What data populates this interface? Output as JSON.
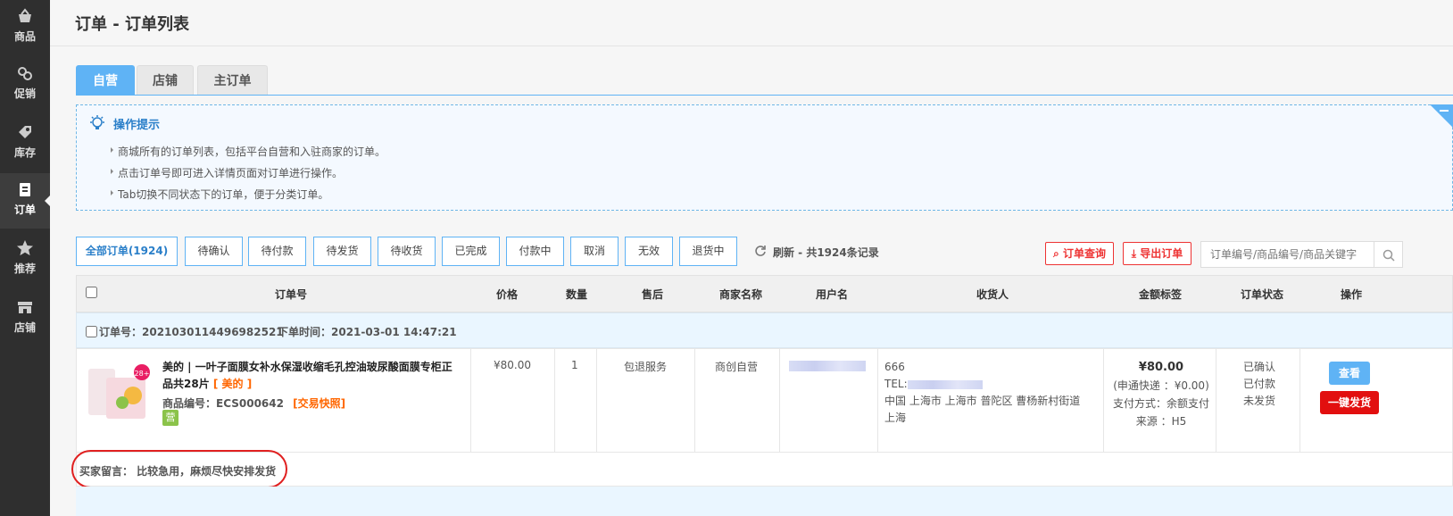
{
  "sidebar": {
    "items": [
      {
        "label": "商品",
        "icon": "basket-icon"
      },
      {
        "label": "促销",
        "icon": "promotion-icon"
      },
      {
        "label": "库存",
        "icon": "tag-icon"
      },
      {
        "label": "订单",
        "icon": "order-icon",
        "active": true
      },
      {
        "label": "推荐",
        "icon": "star-icon"
      },
      {
        "label": "店铺",
        "icon": "store-icon"
      }
    ]
  },
  "header": {
    "title": "订单 - 订单列表"
  },
  "tabs": [
    "自营",
    "店铺",
    "主订单"
  ],
  "tips": {
    "title": "操作提示",
    "items": [
      "商城所有的订单列表，包括平台自营和入驻商家的订单。",
      "点击订单号即可进入详情页面对订单进行操作。",
      "Tab切换不同状态下的订单，便于分类订单。"
    ]
  },
  "filter_tabs": [
    "全部订单(1924)",
    "待确认",
    "待付款",
    "待发货",
    "待收货",
    "已完成",
    "付款中",
    "取消",
    "无效",
    "退货中"
  ],
  "refresh_label": "刷新 - 共1924条记录",
  "actions": {
    "query": "订单查询",
    "export": "导出订单"
  },
  "search": {
    "placeholder": "订单编号/商品编号/商品关键字"
  },
  "table": {
    "headers": [
      "订单号",
      "价格",
      "数量",
      "售后",
      "商家名称",
      "用户名",
      "收货人",
      "金额标签",
      "订单状态",
      "操作"
    ]
  },
  "order": {
    "number_label": "订单号：2021030114496982521",
    "time_label": "下单时间：2021-03-01 14:47:21",
    "product_name": "美的 | 一叶子面膜女补水保湿收缩毛孔控油玻尿酸面膜专柜正品共28片",
    "brand_tag": "[ 美的 ]",
    "sku_label": "商品编号：ECS000642",
    "snapshot_label": "[交易快照]",
    "ying_tag": "营",
    "price": "¥80.00",
    "quantity": "1",
    "after_sale": "包退服务",
    "merchant": "商创自营",
    "consignee_name": "666",
    "consignee_tel": "TEL:",
    "consignee_address": "中国 上海市 上海市 普陀区 曹杨新村街道 上海",
    "amount": "¥80.00",
    "shipping": "(申通快递 ：¥0.00)",
    "payment": "支付方式：余额支付",
    "source": "来源 ：H5",
    "status": [
      "已确认",
      "已付款",
      "未发货"
    ],
    "view_btn": "查看",
    "ship_btn": "一键发货",
    "remark": "买家留言： 比较急用，麻烦尽快安排发货"
  },
  "colors": {
    "accent": "#5fb3f5",
    "danger": "#e20f0f",
    "sidebar": "#2f2f2f"
  }
}
